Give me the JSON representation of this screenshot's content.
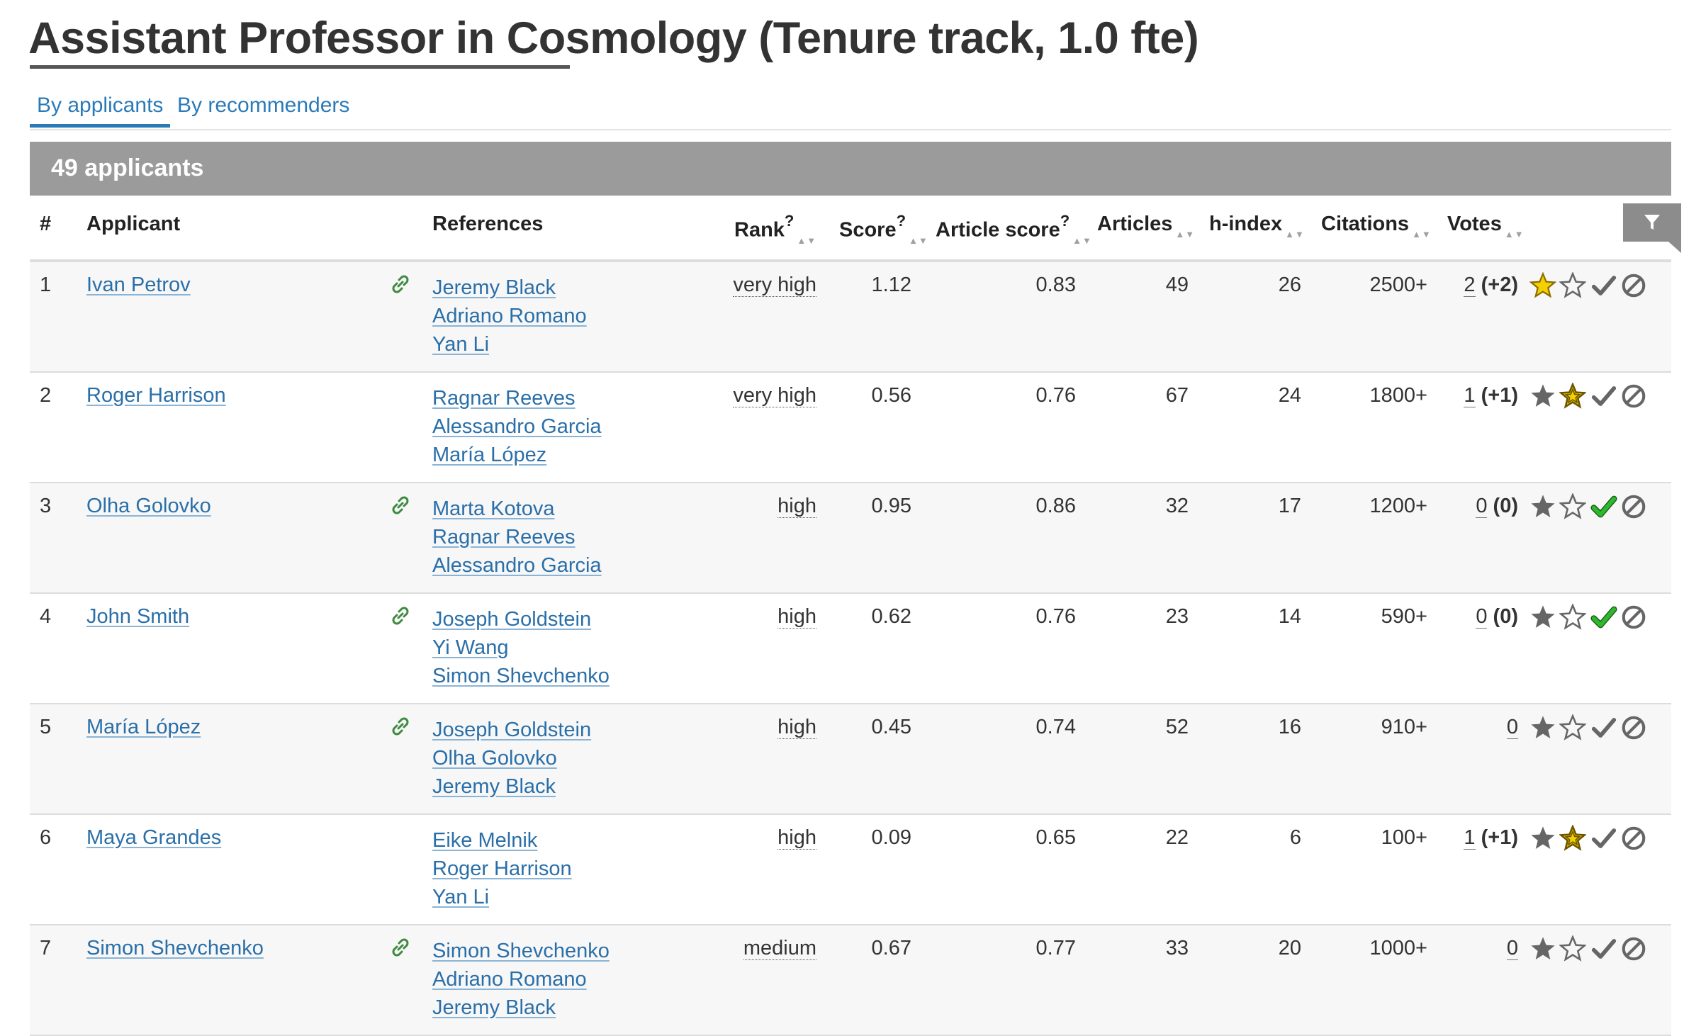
{
  "title": "Assistant Professor in Cosmology (Tenure track, 1.0 fte)",
  "tabs": [
    {
      "label": "By applicants",
      "active": true
    },
    {
      "label": "By recommenders",
      "active": false
    }
  ],
  "summary": "49 applicants",
  "columns": {
    "num": "#",
    "applicant": "Applicant",
    "references": "References",
    "rank": "Rank",
    "score": "Score",
    "article_score": "Article score",
    "articles": "Articles",
    "hindex": "h-index",
    "citations": "Citations",
    "votes": "Votes",
    "help_mark": "?"
  },
  "icons": {
    "filter": "filter-icon",
    "link": "link-icon",
    "star": "star-icon",
    "favorite": "favorite-star-icon",
    "check": "check-icon",
    "reject": "ban-icon"
  },
  "colors": {
    "link": "#2a6fa8",
    "link_icon": "#3e8a3e",
    "header_bar": "#9b9b9b",
    "star_active": "#f5d000",
    "check_active": "#2fb82f",
    "icon_inactive": "#666666"
  },
  "rows": [
    {
      "num": "1",
      "name": "Ivan Petrov",
      "has_link": true,
      "refs": [
        "Jeremy Black",
        "Adriano Romano",
        "Yan Li"
      ],
      "rank": "very high",
      "score": "1.12",
      "article_score": "0.83",
      "articles": "49",
      "hindex": "26",
      "citations": "2500+",
      "votes": "2",
      "votes_delta": "(+2)",
      "star_on": true,
      "fav_on": false,
      "check_on": false
    },
    {
      "num": "2",
      "name": "Roger Harrison",
      "has_link": false,
      "refs": [
        "Ragnar Reeves",
        "Alessandro Garcia",
        "María López"
      ],
      "rank": "very high",
      "score": "0.56",
      "article_score": "0.76",
      "articles": "67",
      "hindex": "24",
      "citations": "1800+",
      "votes": "1",
      "votes_delta": "(+1)",
      "star_on": false,
      "fav_on": true,
      "check_on": false
    },
    {
      "num": "3",
      "name": "Olha Golovko",
      "has_link": true,
      "refs": [
        "Marta Kotova",
        "Ragnar Reeves",
        "Alessandro Garcia"
      ],
      "rank": "high",
      "score": "0.95",
      "article_score": "0.86",
      "articles": "32",
      "hindex": "17",
      "citations": "1200+",
      "votes": "0",
      "votes_delta": "(0)",
      "star_on": false,
      "fav_on": false,
      "check_on": true
    },
    {
      "num": "4",
      "name": "John Smith",
      "has_link": true,
      "refs": [
        "Joseph Goldstein",
        "Yi Wang",
        "Simon Shevchenko"
      ],
      "rank": "high",
      "score": "0.62",
      "article_score": "0.76",
      "articles": "23",
      "hindex": "14",
      "citations": "590+",
      "votes": "0",
      "votes_delta": "(0)",
      "star_on": false,
      "fav_on": false,
      "check_on": true
    },
    {
      "num": "5",
      "name": "María López",
      "has_link": true,
      "refs": [
        "Joseph Goldstein",
        "Olha Golovko",
        "Jeremy Black"
      ],
      "rank": "high",
      "score": "0.45",
      "article_score": "0.74",
      "articles": "52",
      "hindex": "16",
      "citations": "910+",
      "votes": "0",
      "votes_delta": "",
      "star_on": false,
      "fav_on": false,
      "check_on": false
    },
    {
      "num": "6",
      "name": "Maya Grandes",
      "has_link": false,
      "refs": [
        "Eike Melnik",
        "Roger Harrison",
        "Yan Li"
      ],
      "rank": "high",
      "score": "0.09",
      "article_score": "0.65",
      "articles": "22",
      "hindex": "6",
      "citations": "100+",
      "votes": "1",
      "votes_delta": "(+1)",
      "star_on": false,
      "fav_on": true,
      "check_on": false
    },
    {
      "num": "7",
      "name": "Simon Shevchenko",
      "has_link": true,
      "refs": [
        "Simon Shevchenko",
        "Adriano Romano",
        "Jeremy Black"
      ],
      "rank": "medium",
      "score": "0.67",
      "article_score": "0.77",
      "articles": "33",
      "hindex": "20",
      "citations": "1000+",
      "votes": "0",
      "votes_delta": "",
      "star_on": false,
      "fav_on": false,
      "check_on": false
    }
  ]
}
